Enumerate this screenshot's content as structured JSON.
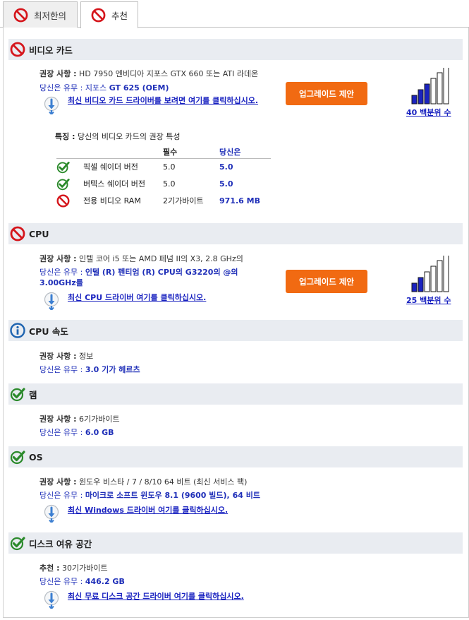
{
  "tabs": [
    {
      "label": "최저한의",
      "status": "fail"
    },
    {
      "label": "추천",
      "status": "fail",
      "active": true
    }
  ],
  "colors": {
    "fail": "#d5151b",
    "pass": "#2b8a2b",
    "info": "#1f64b0",
    "accent": "#f16a12",
    "link": "#1a23c0"
  },
  "video": {
    "title": "비디오 카드",
    "rec_label": "권장 사항 :",
    "rec_value": "HD 7950 엔비디아 지포스 GTX 660 또는 ATI 라데온",
    "you_label": "당신은 유무 :",
    "you_prefix": "지포스",
    "you_value": "GT 625 (OEM)",
    "driver_link": "최신 비디오 카드 드라이버를 보려면 여기를 클릭하십시오.",
    "upgrade": "업그레이드 제안",
    "percentile_label": "40 백분위 수",
    "percentile": 40,
    "feature_label": "특징 :",
    "feature_text": "당신의 비디오 카드의 권장 특성",
    "table_headers": [
      "필수",
      "당신은"
    ],
    "table_rows": [
      {
        "name": "픽셀 쉐이더 버전",
        "required": "5.0",
        "yours": "5.0",
        "status": "pass"
      },
      {
        "name": "버텍스 쉐이더 버전",
        "required": "5.0",
        "yours": "5.0",
        "status": "pass"
      },
      {
        "name": "전용 비디오 RAM",
        "required": "2기가바이트",
        "yours": "971.6 MB",
        "status": "fail"
      }
    ]
  },
  "cpu": {
    "title": "CPU",
    "rec_label": "권장 사항 :",
    "rec_value": "인텔 코어 i5 또는 AMD 페넘 II의 X3, 2.8 GHz의",
    "you_label": "당신은 유무 :",
    "you_value_line1": "인텔 (R) 펜티엄 (R) CPU의 G3220의 @의",
    "you_value_line2": "3.00GHz를",
    "driver_link": "최신 CPU 드라이버 여기를 클릭하십시오.",
    "upgrade": "업그레이드 제안",
    "percentile_label": "25 백분위 수",
    "percentile": 25
  },
  "cpu_speed": {
    "title": "CPU 속도",
    "rec_label": "권장 사항 :",
    "rec_value": "정보",
    "you_label": "당신은 유무 :",
    "you_value": "3.0 기가 헤르츠"
  },
  "ram": {
    "title": "램",
    "rec_label": "권장 사항 :",
    "rec_value": "6기가바이트",
    "you_label": "당신은 유무 :",
    "you_value": "6.0 GB"
  },
  "os": {
    "title": "OS",
    "rec_label": "권장 사항 :",
    "rec_value": "윈도우 비스타 / 7 / 8/10 64 비트 (최신 서비스 팩)",
    "you_label": "당신은 유무 :",
    "you_value": "마이크로 소프트 윈도우 8.1 (9600 빌드), 64 비트",
    "driver_link": "최신 Windows 드라이버 여기를 클릭하십시오."
  },
  "disk": {
    "title": "디스크 여유 공간",
    "rec_label": "추천 :",
    "rec_value": "30기가바이트",
    "you_label": "당신은 유무 :",
    "you_value": "446.2 GB",
    "driver_link": "최신 무료 디스크 공간 드라이버 여기를 클릭하십시오."
  }
}
